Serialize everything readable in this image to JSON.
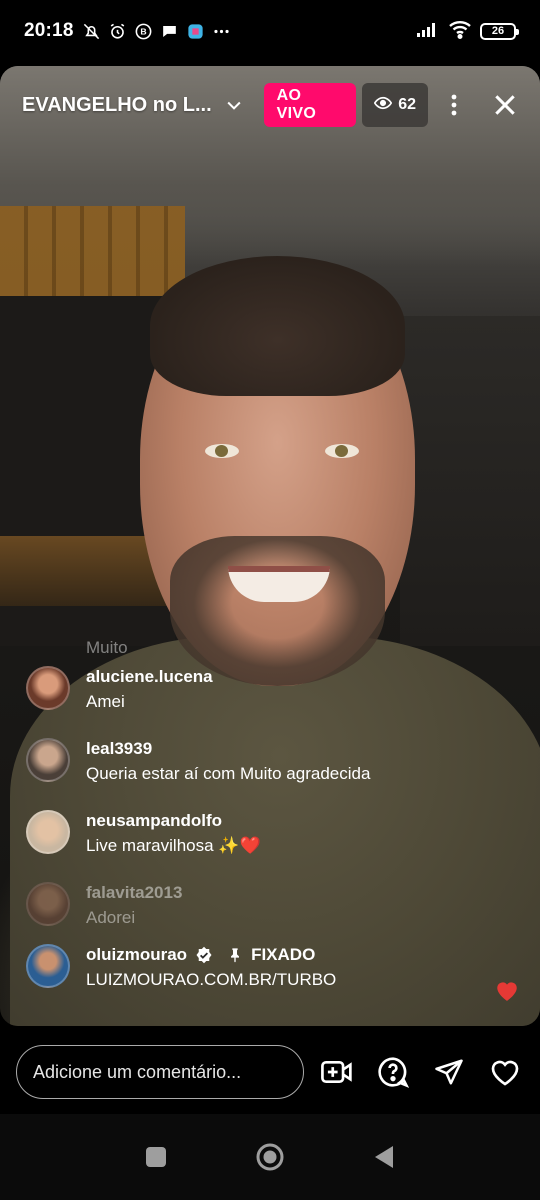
{
  "status_bar": {
    "time": "20:18",
    "battery": "26",
    "left_icons": [
      "mute-icon",
      "alarm-icon",
      "b-icon",
      "chat-icon",
      "app-icon",
      "more-dots-icon"
    ],
    "right_icons": [
      "signal-icon",
      "wifi-icon",
      "battery-icon"
    ]
  },
  "live": {
    "title": "EVANGELHO no L...",
    "badge": "AO VIVO",
    "viewers": "62",
    "badge_color": "#ff0a6c"
  },
  "comments": {
    "faded_top": "Muito",
    "items": [
      {
        "user": "aluciene.lucena",
        "text": "Amei",
        "avatar_color": "#6b3a2a"
      },
      {
        "user": "leal3939",
        "text": "Queria estar aí com Muito agradecida",
        "avatar_color": "#4a3f38"
      },
      {
        "user": "neusampandolfo",
        "text": "Live maravilhosa ✨❤️",
        "avatar_color": "#c9b7a1"
      },
      {
        "user": "falavita2013",
        "text": "Adorei",
        "avatar_color": "#6a3e35"
      }
    ],
    "pinned": {
      "user": "oluizmourao",
      "label": "FIXADO",
      "text": "LUIZMOURAO.COM.BR/TURBO",
      "avatar_color": "#2b5e93"
    }
  },
  "bottom": {
    "comment_placeholder": "Adicione um comentário...",
    "icons": [
      "add-video-icon",
      "question-icon",
      "send-icon",
      "heart-icon"
    ]
  },
  "nav": {
    "buttons": [
      "recents-button",
      "home-button",
      "back-button"
    ]
  }
}
